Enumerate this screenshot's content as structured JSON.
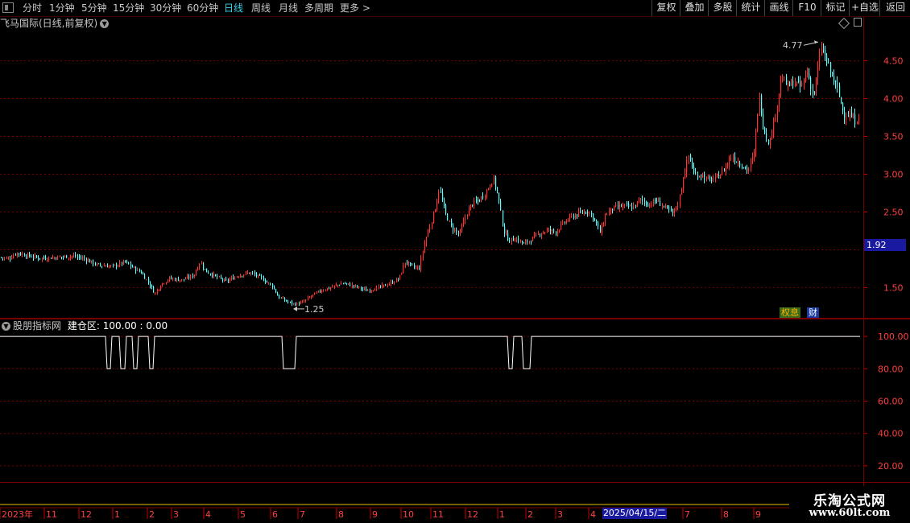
{
  "toolbar": {
    "periods": [
      "分时",
      "1分钟",
      "5分钟",
      "15分钟",
      "30分钟",
      "60分钟",
      "日线",
      "周线",
      "月线",
      "多周期",
      "更多 >"
    ],
    "active_period": "日线",
    "actions": [
      "复权",
      "叠加",
      "多股",
      "统计",
      "画线",
      "F10",
      "标记",
      "+自选",
      "返回"
    ]
  },
  "main_chart": {
    "title": "飞马国际(日线,前复权)",
    "y_labels": [
      "4.50",
      "4.00",
      "3.50",
      "3.00",
      "2.50",
      "1.50"
    ],
    "current_price": "1.92",
    "high_label": "4.77",
    "low_label": "1.25",
    "badges": [
      "权息",
      "财"
    ],
    "colors": {
      "up": "#ff3232",
      "down": "#54ffff",
      "grid": "#7a0000"
    }
  },
  "indicator": {
    "name": "股朋指标网",
    "series_label": "建仓区",
    "value_text": "100.00 : 0.00",
    "y_labels": [
      "100.00",
      "80.00",
      "60.00",
      "40.00",
      "20.00"
    ]
  },
  "time_axis": {
    "labels": [
      "2023年",
      "11",
      "12",
      "1",
      "2",
      "3",
      "4",
      "5",
      "6",
      "7",
      "8",
      "9",
      "10",
      "11",
      "12",
      "1",
      "2",
      "3",
      "4",
      "7",
      "8",
      "9"
    ],
    "cursor_date": "2025/04/15/二"
  },
  "watermark": {
    "line1": "乐淘公式网",
    "line2": "www.60lt.com"
  },
  "chart_data": [
    {
      "type": "candlestick",
      "title": "飞马国际(日线,前复权)",
      "ylim": [
        1.1,
        4.9
      ],
      "y_ticks": [
        1.5,
        2.5,
        3.0,
        3.5,
        4.0,
        4.5
      ],
      "annotations": [
        {
          "label": "4.77",
          "kind": "high"
        },
        {
          "label": "1.25",
          "kind": "low"
        },
        {
          "label": "1.92",
          "kind": "last"
        }
      ],
      "close_path": [
        [
          0,
          1.9
        ],
        [
          10,
          1.88
        ],
        [
          20,
          1.96
        ],
        [
          35,
          1.92
        ],
        [
          50,
          1.89
        ],
        [
          70,
          1.9
        ],
        [
          90,
          1.92
        ],
        [
          105,
          1.88
        ],
        [
          120,
          1.8
        ],
        [
          140,
          1.78
        ],
        [
          155,
          1.84
        ],
        [
          165,
          1.76
        ],
        [
          175,
          1.7
        ],
        [
          185,
          1.55
        ],
        [
          192,
          1.42
        ],
        [
          200,
          1.55
        ],
        [
          210,
          1.62
        ],
        [
          225,
          1.6
        ],
        [
          240,
          1.66
        ],
        [
          248,
          1.84
        ],
        [
          255,
          1.72
        ],
        [
          265,
          1.66
        ],
        [
          280,
          1.58
        ],
        [
          295,
          1.66
        ],
        [
          310,
          1.7
        ],
        [
          325,
          1.62
        ],
        [
          338,
          1.52
        ],
        [
          345,
          1.38
        ],
        [
          355,
          1.32
        ],
        [
          365,
          1.28
        ],
        [
          375,
          1.3
        ],
        [
          385,
          1.38
        ],
        [
          398,
          1.46
        ],
        [
          410,
          1.5
        ],
        [
          425,
          1.56
        ],
        [
          440,
          1.52
        ],
        [
          455,
          1.46
        ],
        [
          470,
          1.5
        ],
        [
          485,
          1.56
        ],
        [
          495,
          1.62
        ],
        [
          503,
          1.85
        ],
        [
          510,
          1.78
        ],
        [
          520,
          1.75
        ],
        [
          527,
          2.1
        ],
        [
          533,
          2.3
        ],
        [
          540,
          2.55
        ],
        [
          545,
          2.82
        ],
        [
          552,
          2.5
        ],
        [
          560,
          2.3
        ],
        [
          570,
          2.2
        ],
        [
          578,
          2.45
        ],
        [
          585,
          2.6
        ],
        [
          595,
          2.66
        ],
        [
          605,
          2.8
        ],
        [
          612,
          2.95
        ],
        [
          618,
          2.72
        ],
        [
          625,
          2.25
        ],
        [
          632,
          2.12
        ],
        [
          640,
          2.15
        ],
        [
          650,
          2.08
        ],
        [
          660,
          2.14
        ],
        [
          670,
          2.22
        ],
        [
          680,
          2.26
        ],
        [
          690,
          2.24
        ],
        [
          700,
          2.36
        ],
        [
          710,
          2.44
        ],
        [
          720,
          2.48
        ],
        [
          730,
          2.52
        ],
        [
          738,
          2.4
        ],
        [
          745,
          2.22
        ],
        [
          752,
          2.48
        ],
        [
          760,
          2.54
        ],
        [
          772,
          2.58
        ],
        [
          785,
          2.56
        ],
        [
          795,
          2.66
        ],
        [
          805,
          2.6
        ],
        [
          815,
          2.65
        ],
        [
          825,
          2.56
        ],
        [
          835,
          2.48
        ],
        [
          842,
          2.62
        ],
        [
          848,
          2.96
        ],
        [
          855,
          3.26
        ],
        [
          862,
          2.98
        ],
        [
          870,
          3.0
        ],
        [
          878,
          2.92
        ],
        [
          888,
          2.94
        ],
        [
          898,
          3.05
        ],
        [
          908,
          3.24
        ],
        [
          918,
          3.15
        ],
        [
          928,
          3.05
        ],
        [
          936,
          3.26
        ],
        [
          942,
          4.05
        ],
        [
          948,
          3.6
        ],
        [
          955,
          3.4
        ],
        [
          962,
          3.78
        ],
        [
          970,
          4.28
        ],
        [
          978,
          4.16
        ],
        [
          986,
          4.22
        ],
        [
          994,
          4.15
        ],
        [
          1002,
          4.36
        ],
        [
          1010,
          4.02
        ],
        [
          1016,
          4.45
        ],
        [
          1020,
          4.7
        ],
        [
          1026,
          4.48
        ],
        [
          1032,
          4.32
        ],
        [
          1040,
          4.1
        ],
        [
          1047,
          3.8
        ],
        [
          1055,
          3.78
        ],
        [
          1062,
          3.7
        ],
        [
          1068,
          3.84
        ]
      ]
    },
    {
      "type": "line",
      "title": "股朋指标网 建仓区",
      "ylim": [
        10,
        110
      ],
      "y_ticks": [
        20,
        40,
        60,
        80,
        100
      ],
      "baseline": 100,
      "series": [
        {
          "name": "建仓区",
          "value": 100,
          "dips_to": 80
        }
      ]
    }
  ]
}
